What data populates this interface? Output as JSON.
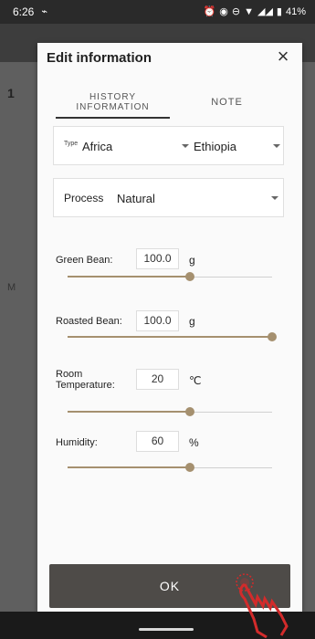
{
  "status_bar": {
    "time": "6:26",
    "battery": "41%",
    "icons": [
      "signal-icon",
      "alarm-icon",
      "data-saver-icon",
      "dnd-icon",
      "wifi-icon",
      "cell-icon",
      "battery-icon"
    ]
  },
  "dialog": {
    "title": "Edit information",
    "close_icon": "×",
    "tabs": [
      {
        "label": "HISTORY\nINFORMATION",
        "active": true
      },
      {
        "label": "NOTE",
        "active": false
      }
    ],
    "type": {
      "label": "Type",
      "region": "Africa",
      "country": "Ethiopia"
    },
    "process": {
      "label": "Process",
      "value": "Natural"
    },
    "green_bean": {
      "label": "Green Bean:",
      "value": "100.0",
      "unit": "g",
      "slider_fraction": 0.6
    },
    "roasted_bean": {
      "label": "Roasted Bean:",
      "value": "100.0",
      "unit": "g",
      "slider_fraction": 1.0
    },
    "room_temperature": {
      "label": "Room\nTemperature:",
      "value": "20",
      "unit": "℃",
      "slider_fraction": 0.6
    },
    "humidity": {
      "label": "Humidity:",
      "value": "60",
      "unit": "%",
      "slider_fraction": 0.6
    },
    "ok_label": "OK"
  },
  "background": {
    "row_number": "1",
    "m_label": "M"
  },
  "colors": {
    "accent": "#a5906f",
    "ok_button": "#4e4b48",
    "hand": "#d22b2b"
  }
}
